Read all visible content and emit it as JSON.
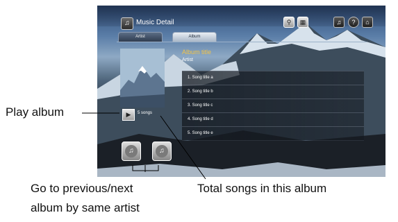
{
  "app": {
    "title": "Music Detail"
  },
  "toolbar": {
    "icons": [
      "search-icon",
      "thumbnail-view-icon",
      "music-icon",
      "help-icon",
      "home-icon"
    ]
  },
  "tabs": [
    {
      "label": "Artist",
      "active": false
    },
    {
      "label": "Album",
      "active": true
    }
  ],
  "album": {
    "title": "Album title",
    "artist": "Artist",
    "song_count_text": "5 songs",
    "songs": [
      "1. Song title a",
      "2. Song title b",
      "3. Song title c",
      "4. Song title d",
      "5. Song title e"
    ]
  },
  "callouts": {
    "play_album": "Play album",
    "prev_next_line1": "Go to previous/next",
    "prev_next_line2": "album by same artist",
    "total_songs": "Total songs in this album"
  },
  "colors": {
    "album_title": "#f2c44a",
    "text": "#ffffff",
    "callout_text": "#111111"
  }
}
